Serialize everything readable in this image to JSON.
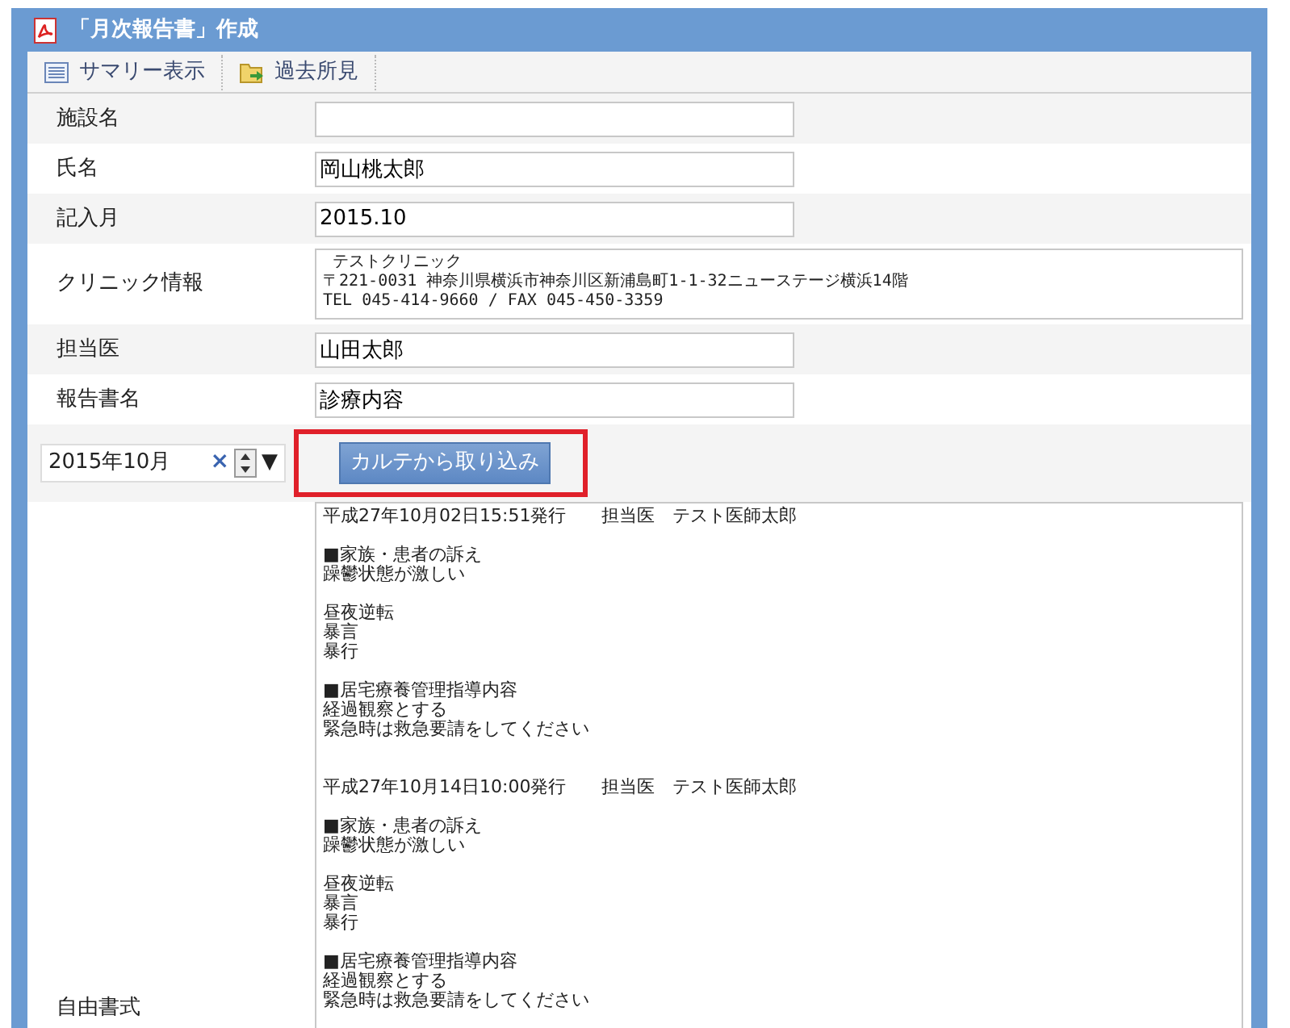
{
  "window": {
    "title": "「月次報告書」作成"
  },
  "toolbar": [
    {
      "label": "サマリー表示",
      "kind": "summary"
    },
    {
      "label": "過去所見",
      "kind": "history"
    }
  ],
  "fields": [
    {
      "label": "施設名",
      "kind": "input"
    },
    {
      "label": "氏名",
      "value": "岡山桃太郎",
      "kind": "input"
    },
    {
      "label": "記入月",
      "value": "2015.10",
      "kind": "input"
    },
    {
      "label": "クリニック情報",
      "lines": [
        " テストクリニック",
        "〒221-0031 神奈川県横浜市神奈川区新浦島町1-1-32ニューステージ横浜14階",
        "TEL 045-414-9660 / FAX 045-450-3359"
      ],
      "kind": "textarea"
    },
    {
      "label": "担当医",
      "value": "山田太郎",
      "kind": "input"
    },
    {
      "label": "報告書名",
      "value": "診療内容",
      "kind": "input"
    }
  ],
  "month_picker": {
    "value": "2015年10月",
    "clear": "×",
    "dropdown": "▼"
  },
  "import_button": {
    "label": "カルテから取り込み",
    "highlighted": true
  },
  "free_text": {
    "label": "自由書式",
    "entries": [
      {
        "heading": "平成27年10月02日15:51発行　　担当医　テスト医師太郎",
        "sections": [
          [
            "■家族・患者の訴え",
            "躁鬱状態が激しい"
          ],
          [
            "昼夜逆転",
            "暴言",
            "暴行"
          ],
          [
            "■居宅療養管理指導内容",
            "経過観察とする",
            "緊急時は救急要請をしてください"
          ]
        ]
      },
      {
        "heading": "平成27年10月14日10:00発行　　担当医　テスト医師太郎",
        "sections": [
          [
            "■家族・患者の訴え",
            "躁鬱状態が激しい"
          ],
          [
            "昼夜逆転",
            "暴言",
            "暴行"
          ],
          [
            "■居宅療養管理指導内容",
            "経過観察とする",
            "緊急時は救急要請をしてください"
          ]
        ]
      }
    ]
  }
}
